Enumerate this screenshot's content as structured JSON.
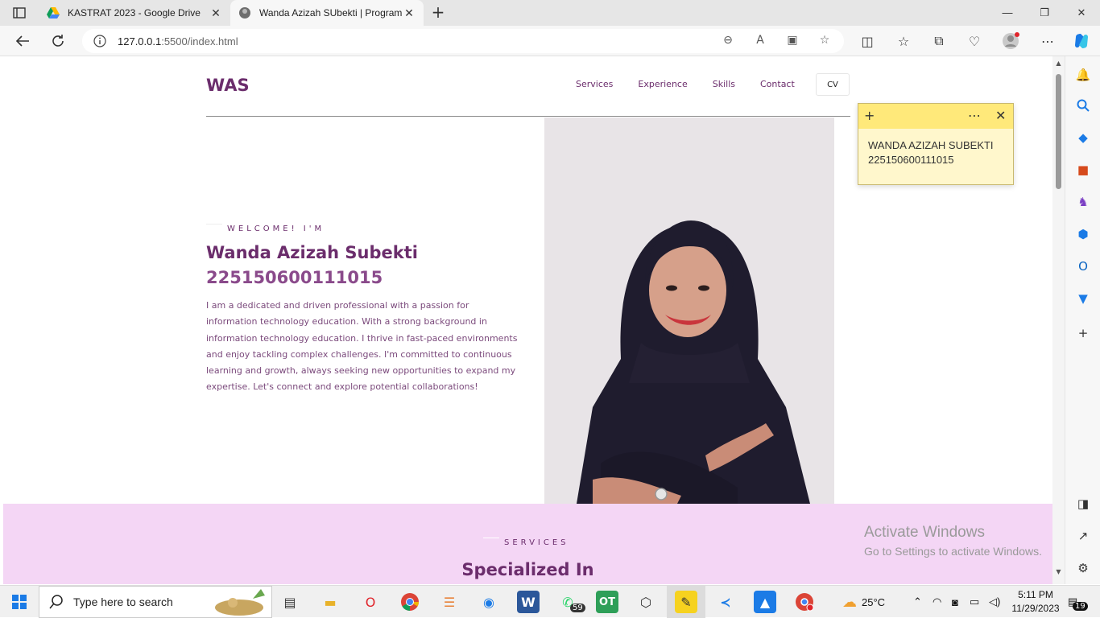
{
  "browser": {
    "tabs": [
      {
        "title": "KASTRAT 2023 - Google Drive",
        "favicon": "google-drive-icon"
      },
      {
        "title": "Wanda Azizah SUbekti | Program",
        "favicon": "avatar-favicon",
        "active": true
      }
    ],
    "url_host": "127.0.0.1",
    "url_path": ":5500/index.html"
  },
  "site": {
    "logo": "WAS",
    "nav": [
      "Services",
      "Experience",
      "Skills",
      "Contact"
    ],
    "cv_label": "CV",
    "hero": {
      "eyebrow": "WELCOME! I'M",
      "name": "Wanda Azizah Subekti",
      "student_id": "225150600111015",
      "bio": "I am a dedicated and driven professional with a passion for information technology education. With a strong background in information technology education. I thrive in fast-paced environments and enjoy tackling complex challenges. I'm committed to continuous learning and growth, always seeking new opportunities to expand my expertise. Let's connect and explore potential collaborations!"
    },
    "services": {
      "eyebrow": "SERVICES",
      "title": "Specialized In"
    },
    "colors": {
      "primary": "#6b2d6c",
      "services_bg": "#f4d6f5"
    }
  },
  "sticky_note": {
    "line1": "WANDA AZIZAH SUBEKTI",
    "line2": "225150600111015"
  },
  "watermark": {
    "title": "Activate Windows",
    "subtitle": "Go to Settings to activate Windows."
  },
  "taskbar": {
    "search_placeholder": "Type here to search",
    "whatsapp_badge": "59",
    "weather": "25°C",
    "time": "5:11 PM",
    "date": "11/29/2023",
    "notifications": "19"
  }
}
